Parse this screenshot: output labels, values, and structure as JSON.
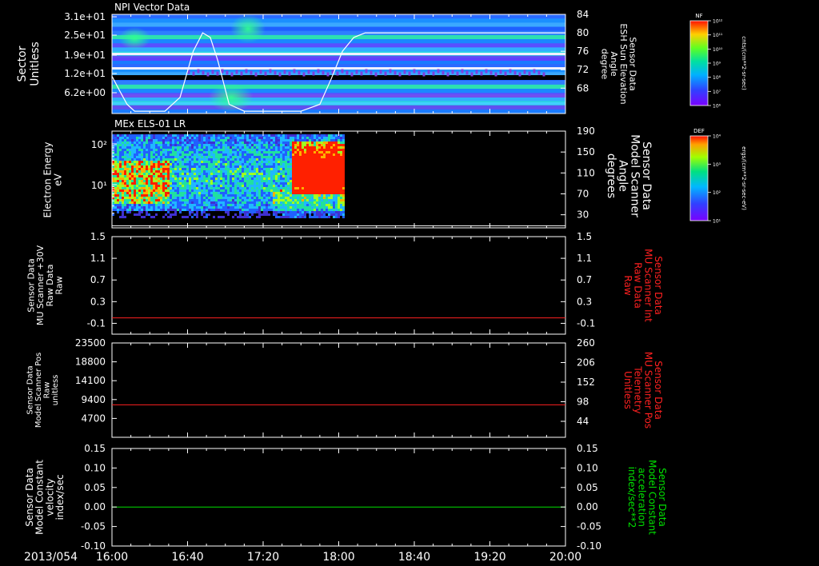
{
  "figure": {
    "date_label": "2013/054",
    "time_ticks": [
      "16:00",
      "16:40",
      "17:20",
      "18:00",
      "18:40",
      "19:20",
      "20:00"
    ],
    "time_range_minutes": [
      0,
      240
    ],
    "colors": {
      "background": "#000000",
      "axes": "#ffffff",
      "red_trace": "#ff2020",
      "green_trace": "#00e000"
    }
  },
  "chart_data": [
    {
      "type": "heatmap",
      "title": "NPI Vector Data",
      "ylabel": "Sector\nUnitless",
      "yticks": [
        "3.1e+01",
        "2.5e+01",
        "1.9e+01",
        "1.2e+01",
        "6.2e+00"
      ],
      "y2label": "Sensor Data\nESH Sun Elevation\nAngle\ndegree",
      "y2ticks": [
        84,
        80,
        76,
        72,
        68
      ],
      "y2lim": [
        62.5,
        84
      ],
      "colorbar": {
        "label": "NF",
        "units": "cnts/(cm**2-sr-sec)",
        "ticks": [
          "10¹²",
          "10¹¹",
          "10¹⁰",
          "10⁹",
          "10⁸",
          "10⁷",
          "10⁶"
        ]
      },
      "overlay_line": {
        "name": "ESH Sun Elevation Angle",
        "x": [
          0,
          4,
          8,
          12,
          18,
          28,
          36,
          43,
          48,
          52,
          56,
          62,
          70,
          100,
          110,
          116,
          122,
          128,
          134,
          140,
          240
        ],
        "y": [
          70.6,
          67.5,
          64.5,
          63,
          63,
          63,
          66,
          76,
          80,
          79,
          74,
          64.5,
          63,
          63,
          64.5,
          70,
          76,
          79,
          80,
          80,
          80
        ]
      },
      "data_extent_minutes": [
        0,
        240
      ]
    },
    {
      "type": "heatmap",
      "title": "MEx ELS-01 LR",
      "ylabel": "Electron Energy\neV",
      "yticks": [
        "10²",
        "10¹"
      ],
      "y2label": "Sensor Data\nModel Scanner\nAngle\ndegrees",
      "y2ticks": [
        190,
        150,
        110,
        70,
        30
      ],
      "y2lim": [
        5,
        190
      ],
      "colorbar": {
        "label": "DEF",
        "units": "ergs/(cm**2-sr-sec-eV)",
        "ticks": [
          "10⁴",
          "10³",
          "10²",
          "10¹"
        ]
      },
      "data_extent_minutes": [
        0,
        123
      ],
      "overlay_line": {
        "name": "Model Scanner Angle",
        "x": [
          0,
          240
        ],
        "y": [
          9,
          9
        ]
      }
    },
    {
      "type": "line",
      "ylabel": "Sensor Data\nMU Scanner +30V\nRaw Data\nRaw",
      "yticks": [
        "1.5",
        "1.1",
        "0.7",
        "0.3",
        "-0.1"
      ],
      "ylim": [
        -0.3,
        1.5
      ],
      "y2label": "Sensor Data\nMU Scanner Int\nRaw Data\nRaw",
      "y2ticks": [
        "1.5",
        "1.1",
        "0.7",
        "0.3",
        "-0.1"
      ],
      "y2lim": [
        -0.3,
        1.5
      ],
      "series": [
        {
          "x": [
            0,
            240
          ],
          "values": [
            0.0,
            0.0
          ],
          "color": "#ff2020"
        }
      ]
    },
    {
      "type": "line",
      "ylabel": "Sensor Data\nModel Scanner Pos\nRaw\nunitless",
      "yticks": [
        "23500",
        "18800",
        "14100",
        "9400",
        "4700"
      ],
      "ylim": [
        0,
        23500
      ],
      "y2label": "Sensor Data\nMU Scanner Pos\nTelemetry\nUnitless",
      "y2ticks": [
        "260",
        "206",
        "152",
        "98",
        "44"
      ],
      "y2lim": [
        0,
        260
      ],
      "series": [
        {
          "x": [
            0,
            240
          ],
          "values": [
            8100,
            8100
          ],
          "color": "#ff2020"
        }
      ]
    },
    {
      "type": "line",
      "ylabel": "Sensor Data\nModel Constant\nvelocity\nindex/sec",
      "yticks": [
        "0.15",
        "0.10",
        "0.05",
        "0.00",
        "-0.05",
        "-0.10"
      ],
      "ylim": [
        -0.1,
        0.15
      ],
      "y2label": "Sensor Data\nModel Constant\nacceleration\nindex/sec**2",
      "y2ticks": [
        "0.15",
        "0.10",
        "0.05",
        "0.00",
        "-0.05",
        "-0.10"
      ],
      "y2lim": [
        -0.1,
        0.15
      ],
      "series": [
        {
          "x": [
            0,
            240
          ],
          "values": [
            0.0,
            0.0
          ],
          "color": "#00e000"
        }
      ]
    }
  ]
}
